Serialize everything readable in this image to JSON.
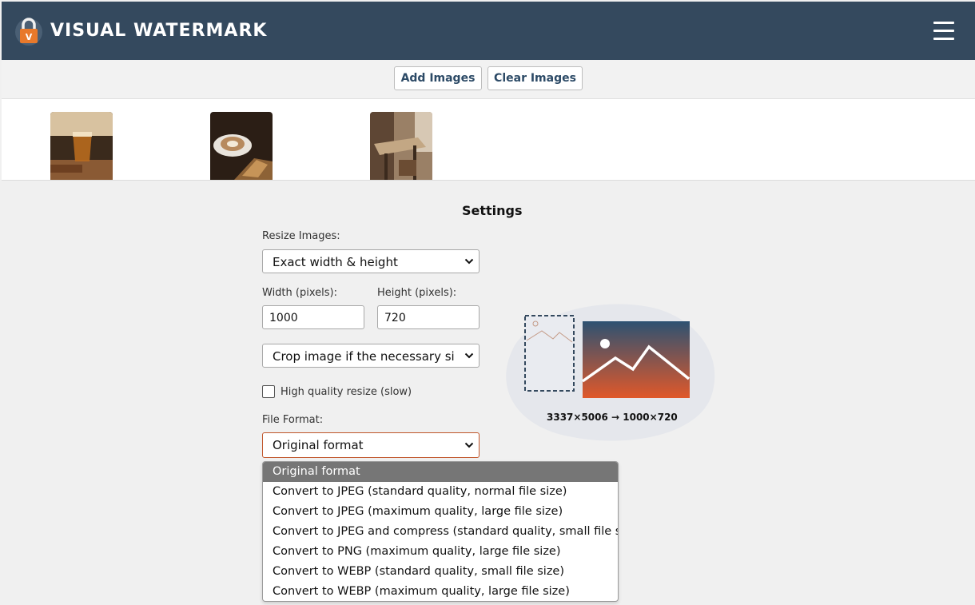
{
  "header": {
    "app_title": "VISUAL WATERMARK",
    "logo_letter": "V",
    "logo_icon": "padlock-icon",
    "menu_icon": "hamburger-menu-icon",
    "background": "#34495e"
  },
  "toolbar": {
    "add_images": "Add Images",
    "clear_images": "Clear Images"
  },
  "thumbnails": [
    "coffee-drink-photo",
    "latte-and-pastry-photo",
    "cafe-table-photo"
  ],
  "settings": {
    "title": "Settings",
    "resize_label": "Resize Images:",
    "resize_value": "Exact width & height",
    "width_label": "Width (pixels):",
    "width_value": "1000",
    "height_label": "Height (pixels):",
    "height_value": "720",
    "crop_value": "Crop image if the necessary size re",
    "hq_label": "High quality resize (slow)",
    "hq_checked": false,
    "format_label": "File Format:",
    "format_value": "Original format",
    "format_options": [
      "Original format",
      "Convert to JPEG (standard quality, normal file size)",
      "Convert to JPEG (maximum quality, large file size)",
      "Convert to JPEG and compress (standard quality, small file size)",
      "Convert to PNG (maximum quality, large file size)",
      "Convert to WEBP (standard quality, small file size)",
      "Convert to WEBP (maximum quality, large file size)"
    ],
    "selected_option": 0,
    "resize_caption": "3337×5006 → 1000×720"
  },
  "colors": {
    "accent": "#2c4a66",
    "focus_border": "#c0552a",
    "option_highlight": "#767676"
  }
}
